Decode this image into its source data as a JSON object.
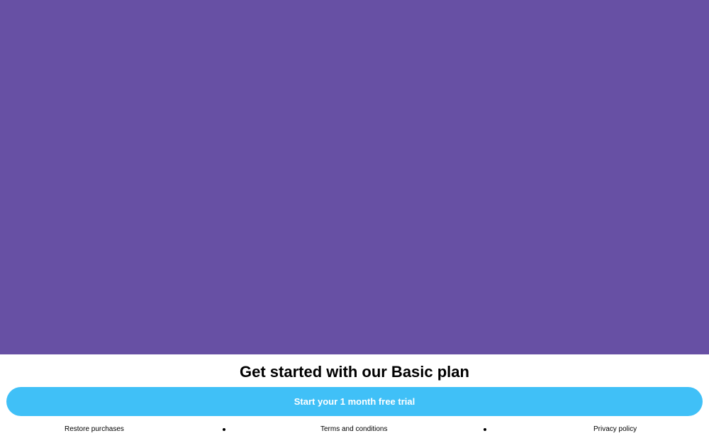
{
  "paywall": {
    "title": "Get started with our Basic plan",
    "cta_label": "Start your 1 month free trial"
  },
  "footer": {
    "restore_label": "Restore purchases",
    "terms_label": "Terms and conditions",
    "privacy_label": "Privacy policy"
  },
  "colors": {
    "hero_background": "#6750a4",
    "cta_background": "#40c0f7",
    "cta_text": "#ffffff"
  }
}
